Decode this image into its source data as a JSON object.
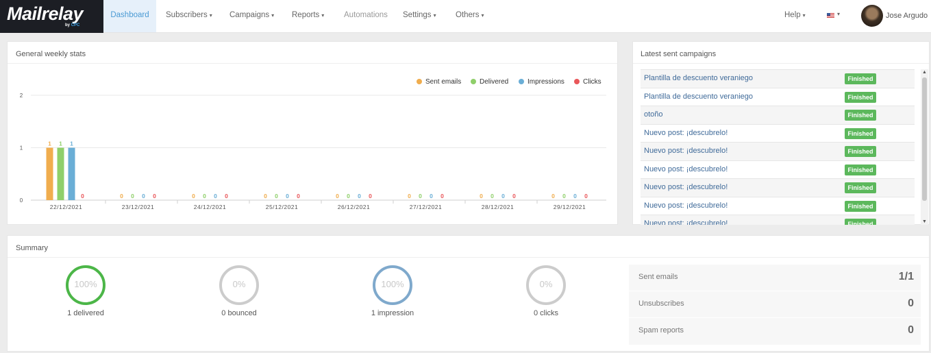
{
  "brand": {
    "logo_text": "ailrelay",
    "logo_prefix": "M",
    "by_text": "by",
    "by_brand": "CPC"
  },
  "nav": {
    "items": [
      {
        "label": "Dashboard",
        "caret": ""
      },
      {
        "label": "Subscribers",
        "caret": "▾"
      },
      {
        "label": "Campaigns",
        "caret": "▾"
      },
      {
        "label": "Reports",
        "caret": "▾"
      },
      {
        "label": "Automations",
        "caret": ""
      },
      {
        "label": "Settings",
        "caret": "▾"
      },
      {
        "label": "Others",
        "caret": "▾"
      }
    ],
    "help": "Help",
    "help_caret": "▾",
    "language_caret": "▾",
    "user_name": "Jose Argudo"
  },
  "weekly_stats": {
    "title": "General weekly stats",
    "legend": [
      {
        "name": "Sent emails",
        "color": "#f0ad4e"
      },
      {
        "name": "Delivered",
        "color": "#8fcf6a"
      },
      {
        "name": "Impressions",
        "color": "#6aaed6"
      },
      {
        "name": "Clicks",
        "color": "#e9575a"
      }
    ]
  },
  "chart_data": {
    "type": "bar",
    "categories": [
      "22/12/2021",
      "23/12/2021",
      "24/12/2021",
      "25/12/2021",
      "26/12/2021",
      "27/12/2021",
      "28/12/2021",
      "29/12/2021"
    ],
    "series": [
      {
        "name": "Sent emails",
        "values": [
          1,
          0,
          0,
          0,
          0,
          0,
          0,
          0
        ]
      },
      {
        "name": "Delivered",
        "values": [
          1,
          0,
          0,
          0,
          0,
          0,
          0,
          0
        ]
      },
      {
        "name": "Impressions",
        "values": [
          1,
          0,
          0,
          0,
          0,
          0,
          0,
          0
        ]
      },
      {
        "name": "Clicks",
        "values": [
          0,
          0,
          0,
          0,
          0,
          0,
          0,
          0
        ]
      }
    ],
    "yticks": [
      0,
      1,
      2
    ],
    "ylim": [
      0,
      2
    ],
    "grid": true,
    "legend_position": "top-right"
  },
  "latest_campaigns": {
    "title": "Latest sent campaigns",
    "rows": [
      {
        "name": "Plantilla de descuento veraniego",
        "status": "Finished"
      },
      {
        "name": "Plantilla de descuento veraniego",
        "status": "Finished"
      },
      {
        "name": "otoño",
        "status": "Finished"
      },
      {
        "name": "Nuevo post: ¡descubrelo!",
        "status": "Finished"
      },
      {
        "name": "Nuevo post: ¡descubrelo!",
        "status": "Finished"
      },
      {
        "name": "Nuevo post: ¡descubrelo!",
        "status": "Finished"
      },
      {
        "name": "Nuevo post: ¡descubrelo!",
        "status": "Finished"
      },
      {
        "name": "Nuevo post: ¡descubrelo!",
        "status": "Finished"
      },
      {
        "name": "Nuevo post: ¡descubrelo!",
        "status": "Finished"
      }
    ],
    "scroll_up": "▲",
    "scroll_down": "▼"
  },
  "summary": {
    "title": "Summary",
    "rings": [
      {
        "percent": "100%",
        "label": "1 delivered",
        "color": "#4cb648"
      },
      {
        "percent": "0%",
        "label": "0 bounced",
        "color": "#cccccc"
      },
      {
        "percent": "100%",
        "label": "1 impression",
        "color": "#7fa9cc"
      },
      {
        "percent": "0%",
        "label": "0 clicks",
        "color": "#cccccc"
      }
    ],
    "stats": [
      {
        "label": "Sent emails",
        "value": "1/1"
      },
      {
        "label": "Unsubscribes",
        "value": "0"
      },
      {
        "label": "Spam reports",
        "value": "0"
      }
    ]
  }
}
